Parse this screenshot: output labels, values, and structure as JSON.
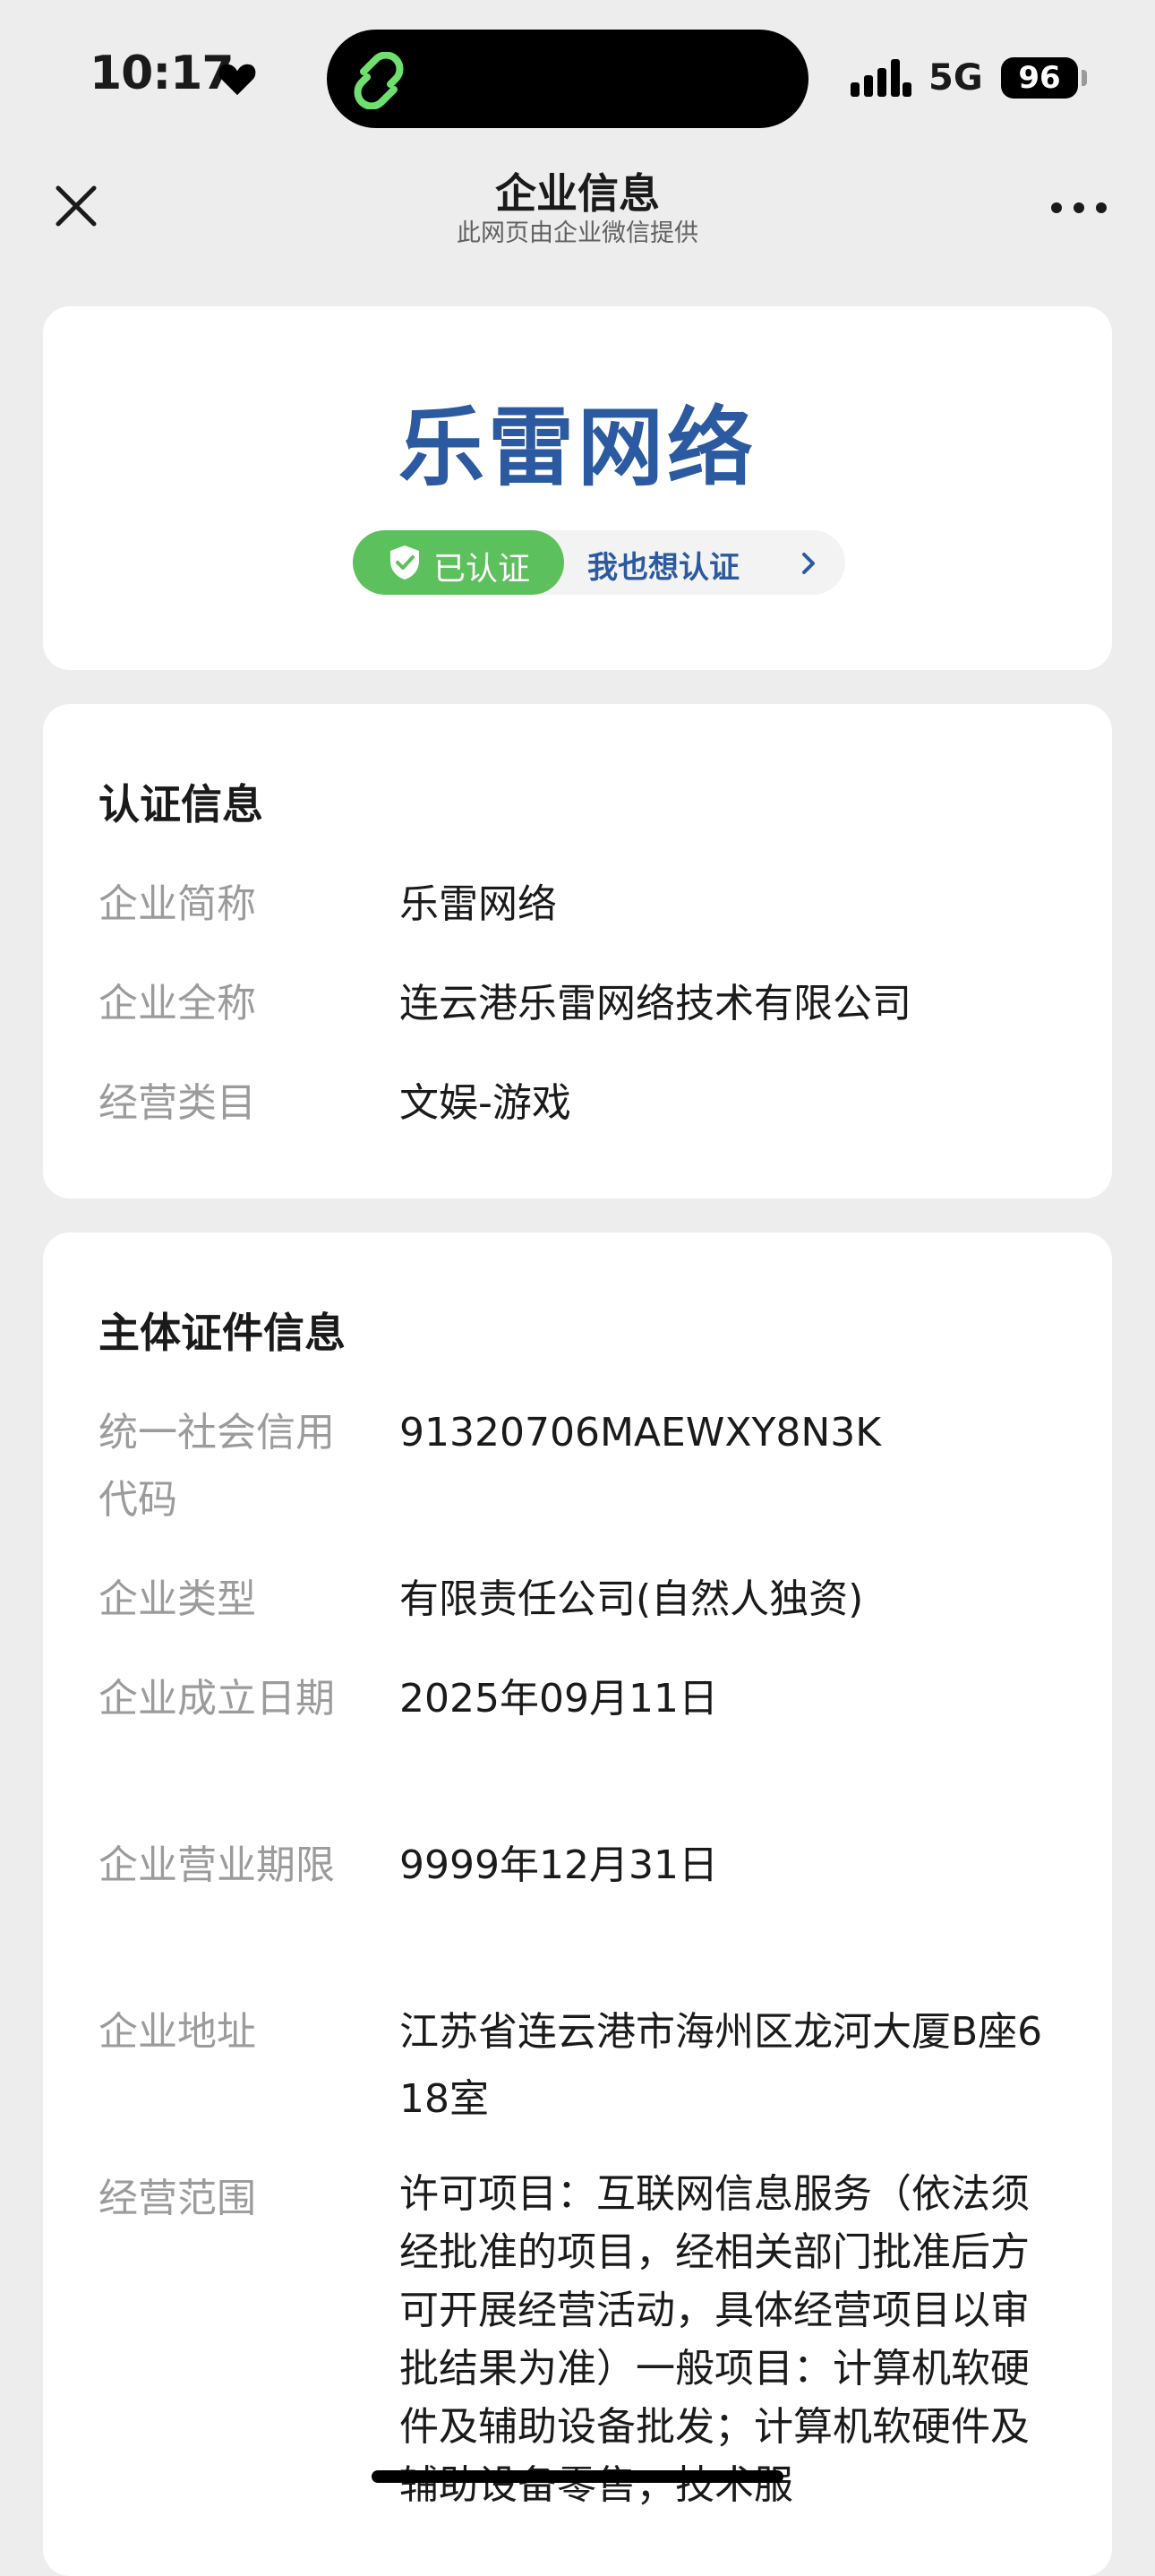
{
  "status_bar": {
    "time": "10:17",
    "network": "5G",
    "battery": "96"
  },
  "nav": {
    "title": "企业信息",
    "subtitle": "此网页由企业微信提供"
  },
  "hero": {
    "company_name": "乐雷网络",
    "certified_label": "已认证",
    "cert_link_label": "我也想认证"
  },
  "auth_info": {
    "title": "认证信息",
    "rows": [
      {
        "label": "企业简称",
        "value": "乐雷网络"
      },
      {
        "label": "企业全称",
        "value": "连云港乐雷网络技术有限公司"
      },
      {
        "label": "经营类目",
        "value": "文娱-游戏"
      }
    ]
  },
  "entity_info": {
    "title": "主体证件信息",
    "rows": [
      {
        "label": "统一社会信用代码",
        "value": "91320706MAEWXY8N3K"
      },
      {
        "label": "企业类型",
        "value": "有限责任公司(自然人独资)"
      },
      {
        "label": "企业成立日期",
        "value": "2025年09月11日"
      },
      {
        "label": "企业营业期限",
        "value": "9999年12月31日"
      },
      {
        "label": "企业地址",
        "value": "江苏省连云港市海州区龙河大厦B座618室"
      },
      {
        "label": "经营范围",
        "value": "许可项目：互联网信息服务（依法须经批准的项目，经相关部门批准后方可开展经营活动，具体经营项目以审批结果为准）一般项目：计算机软硬件及辅助设备批发；计算机软硬件及辅助设备零售；技术服"
      }
    ]
  },
  "colors": {
    "brand_blue": "#2c5aa0",
    "certified_green": "#5cc05c",
    "page_bg": "#ededed"
  }
}
